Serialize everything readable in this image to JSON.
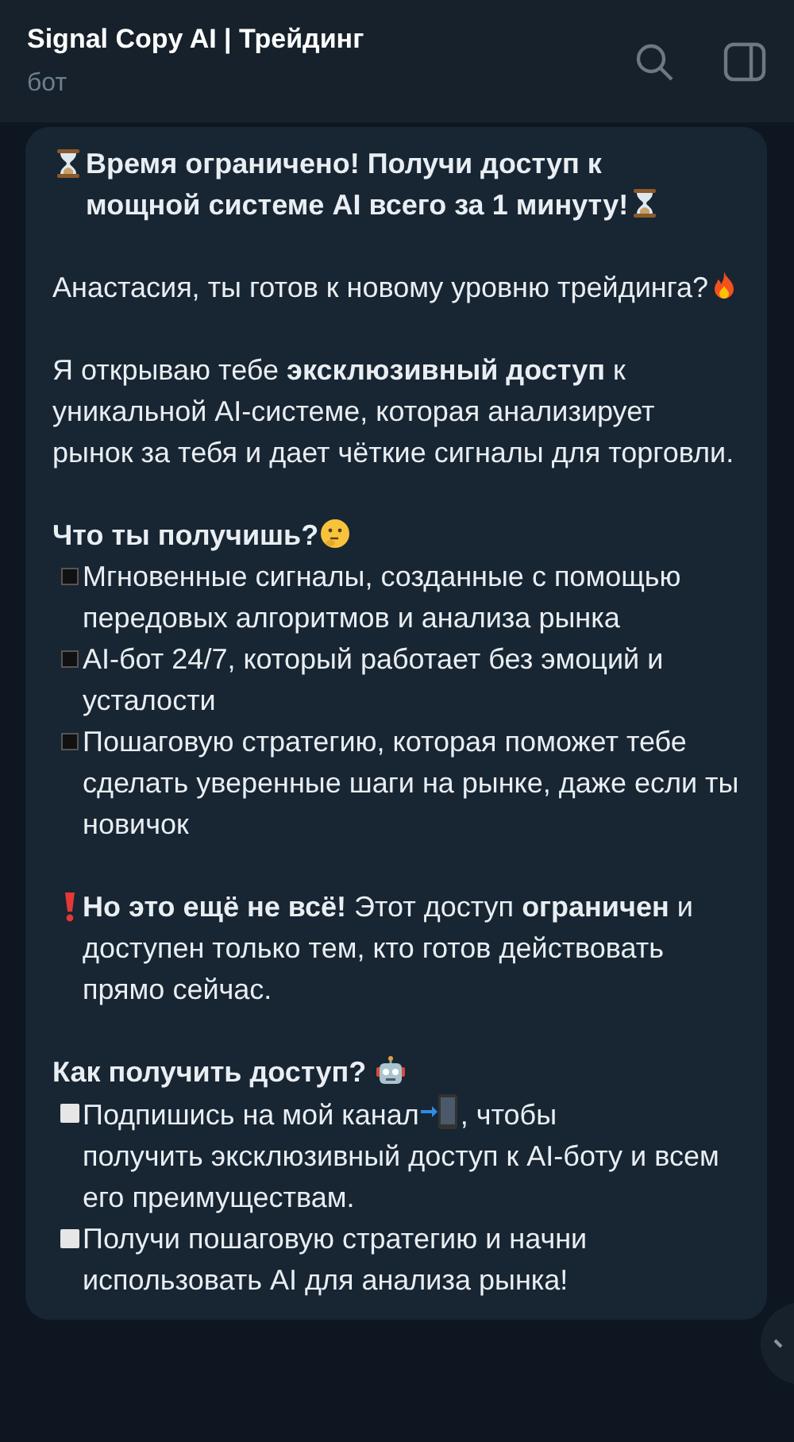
{
  "header": {
    "title": "Signal Copy AI | Трейдинг",
    "subtitle": "бот"
  },
  "message": {
    "paragraphs": [
      {
        "lines": [
          {
            "bold": true,
            "parts": [
              {
                "kind": "hourglass"
              },
              {
                "kind": "text",
                "text": " Время ограничено! Получи доступ к"
              },
              {
                "kind": "break"
              },
              {
                "kind": "text",
                "text": "мощной системе AI всего за 1 минуту!"
              },
              {
                "kind": "hourglass"
              }
            ]
          }
        ]
      },
      {
        "lines": [
          {
            "bold": false,
            "parts": [
              {
                "kind": "text",
                "text": "Анастасия, ты готов к новому уровню трейдинга?"
              },
              {
                "kind": "fire"
              }
            ]
          }
        ]
      },
      {
        "lines": [
          {
            "bold": false,
            "parts": [
              {
                "kind": "text",
                "text": "Я открываю тебе **эксклюзивный доступ** к уникальной AI-системе, которая анализирует рынок за тебя и дает чёткие сигналы для торговли."
              }
            ]
          }
        ]
      },
      {
        "lines": [
          {
            "bold": true,
            "parts": [
              {
                "kind": "text",
                "text": "Что ты получишь?"
              },
              {
                "kind": "thinking"
              }
            ]
          },
          {
            "bold": false,
            "parts": [
              {
                "kind": "dark-square"
              },
              {
                "kind": "text",
                "text": " Мгновенные сигналы, созданные с помощью передовых алгоритмов и анализа рынка"
              }
            ]
          },
          {
            "bold": false,
            "parts": [
              {
                "kind": "dark-square"
              },
              {
                "kind": "text",
                "text": " AI-бот 24/7, который работает без эмоций и усталости"
              }
            ]
          },
          {
            "bold": false,
            "parts": [
              {
                "kind": "dark-square"
              },
              {
                "kind": "text",
                "text": " Пошаговую стратегию, которая поможет тебе сделать уверенные шаги на рынке, даже если ты новичок"
              }
            ]
          }
        ]
      },
      {
        "lines": [
          {
            "bold": false,
            "parts": [
              {
                "kind": "exclamation"
              },
              {
                "kind": "text",
                "text": " **Но это ещё не всё!** Этот доступ **ограничен** и доступен только тем, кто готов действовать прямо сейчас."
              }
            ]
          }
        ]
      },
      {
        "lines": [
          {
            "bold": true,
            "parts": [
              {
                "kind": "text",
                "text": "Как получить доступ? "
              },
              {
                "kind": "robot"
              }
            ]
          },
          {
            "bold": false,
            "parts": [
              {
                "kind": "light-square"
              },
              {
                "kind": "text",
                "text": " Подпишись на мой канал"
              },
              {
                "kind": "phone"
              },
              {
                "kind": "text",
                "text": ", чтобы"
              },
              {
                "kind": "break"
              },
              {
                "kind": "text",
                "text": "получить эксклюзивный доступ к AI-боту и всем его преимуществам."
              }
            ]
          },
          {
            "bold": false,
            "parts": [
              {
                "kind": "light-square"
              },
              {
                "kind": "text",
                "text": " Получи пошаговую стратегию и начни использовать AI для анализа рынка!"
              }
            ]
          }
        ]
      }
    ]
  }
}
